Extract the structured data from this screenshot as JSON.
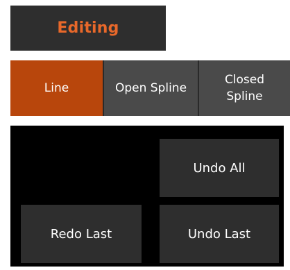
{
  "header": {
    "title": "Editing",
    "title_color": "#e8682a"
  },
  "modes": {
    "items": [
      {
        "label": "Line",
        "active": true
      },
      {
        "label": "Open Spline",
        "active": false
      },
      {
        "label": "Closed\nSpline",
        "active": false
      }
    ],
    "active_color": "#b8460c"
  },
  "actions": {
    "undo_all": "Undo All",
    "redo_last": "Redo Last",
    "undo_last": "Undo Last"
  }
}
